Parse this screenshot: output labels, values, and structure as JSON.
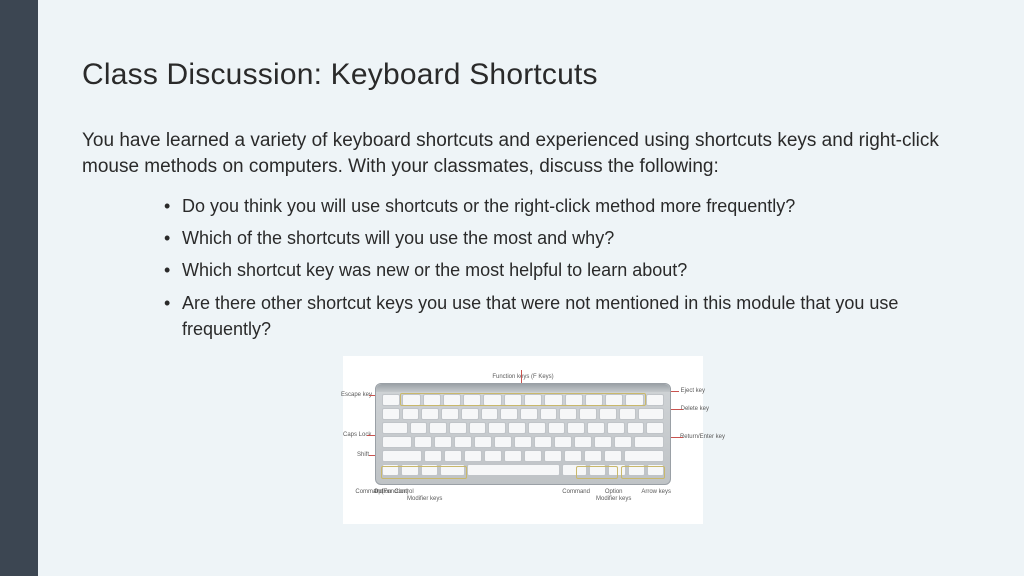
{
  "title": "Class Discussion: Keyboard Shortcuts",
  "intro": "You have learned a variety of keyboard shortcuts and experienced using shortcuts keys and right-click mouse methods on computers. With your classmates, discuss the following:",
  "bullets": [
    "Do you think you will use shortcuts or the right-click method more frequently?",
    "Which of the shortcuts will you use the most and why?",
    "Which shortcut key was new or the most helpful to learn about?",
    "Are there other shortcut keys you use that were not mentioned in this module that you use frequently?"
  ],
  "keyboard": {
    "top_label": "Function keys (F Keys)",
    "left_labels": {
      "escape": "Escape key",
      "caps": "Caps Lock",
      "shift": "Shift"
    },
    "right_labels": {
      "eject": "Eject key",
      "delete": "Delete key",
      "return": "Return/Enter key"
    },
    "bottom_left": {
      "fn": "fn (Function)",
      "control": "Control",
      "option": "Option",
      "command": "Command",
      "group": "Modifier keys"
    },
    "bottom_right": {
      "command": "Command",
      "option": "Option",
      "arrows": "Arrow keys",
      "group": "Modifier keys"
    }
  }
}
